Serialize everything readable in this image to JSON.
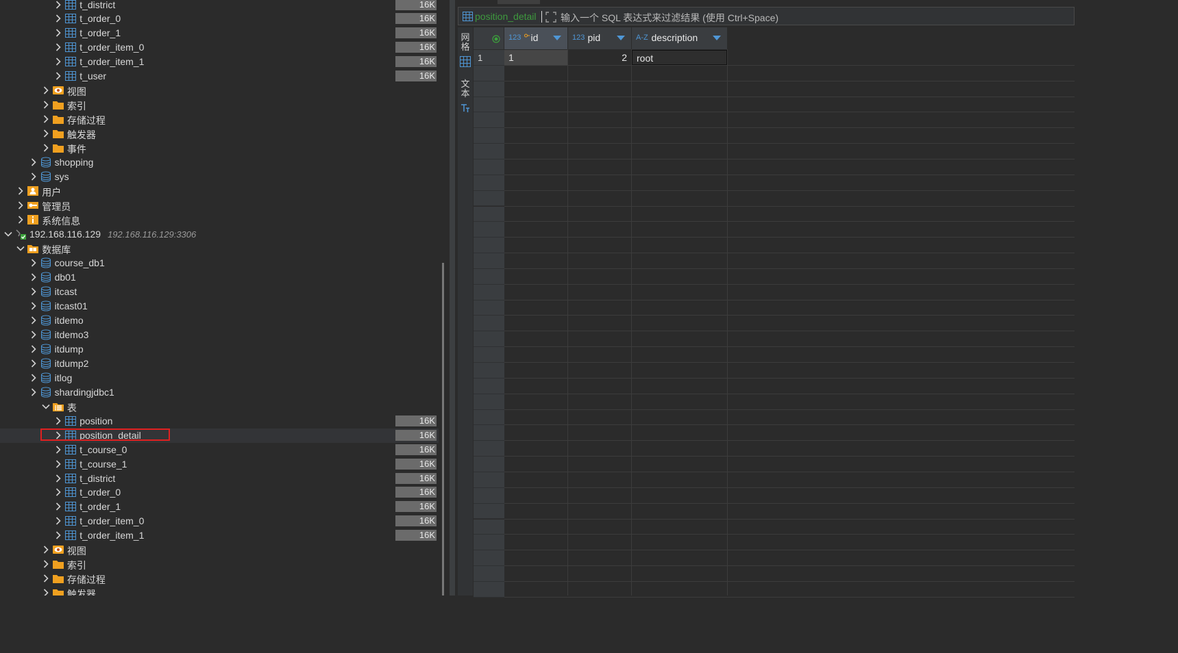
{
  "tree": {
    "sizes_label": "16K",
    "connection": {
      "host": "192.168.116.129",
      "address": "192.168.116.129:3306"
    },
    "rows": [
      {
        "label": "t_district",
        "type": "table",
        "size": "16K"
      },
      {
        "label": "t_order_0",
        "type": "table",
        "size": "16K"
      },
      {
        "label": "t_order_1",
        "type": "table",
        "size": "16K"
      },
      {
        "label": "t_order_item_0",
        "type": "table",
        "size": "16K"
      },
      {
        "label": "t_order_item_1",
        "type": "table",
        "size": "16K"
      },
      {
        "label": "t_user",
        "type": "table",
        "size": "16K"
      },
      {
        "label": "视图",
        "type": "views"
      },
      {
        "label": "索引",
        "type": "folder"
      },
      {
        "label": "存储过程",
        "type": "folder"
      },
      {
        "label": "触发器",
        "type": "folder"
      },
      {
        "label": "事件",
        "type": "folder"
      },
      {
        "label": "shopping",
        "type": "db"
      },
      {
        "label": "sys",
        "type": "db"
      },
      {
        "label": "用户",
        "type": "users"
      },
      {
        "label": "管理员",
        "type": "admin"
      },
      {
        "label": "系统信息",
        "type": "info"
      },
      {
        "label": "192.168.116.129",
        "type": "connection",
        "sub": "192.168.116.129:3306"
      },
      {
        "label": "数据库",
        "type": "databases"
      },
      {
        "label": "course_db1",
        "type": "db"
      },
      {
        "label": "db01",
        "type": "db"
      },
      {
        "label": "itcast",
        "type": "db"
      },
      {
        "label": "itcast01",
        "type": "db"
      },
      {
        "label": "itdemo",
        "type": "db"
      },
      {
        "label": "itdemo3",
        "type": "db"
      },
      {
        "label": "itdump",
        "type": "db"
      },
      {
        "label": "itdump2",
        "type": "db"
      },
      {
        "label": "itlog",
        "type": "db"
      },
      {
        "label": "shardingjdbc1",
        "type": "db"
      },
      {
        "label": "表",
        "type": "tables"
      },
      {
        "label": "position",
        "type": "table",
        "size": "16K"
      },
      {
        "label": "position_detail",
        "type": "table",
        "size": "16K",
        "selected": true
      },
      {
        "label": "t_course_0",
        "type": "table",
        "size": "16K"
      },
      {
        "label": "t_course_1",
        "type": "table",
        "size": "16K"
      },
      {
        "label": "t_district",
        "type": "table",
        "size": "16K"
      },
      {
        "label": "t_order_0",
        "type": "table",
        "size": "16K"
      },
      {
        "label": "t_order_1",
        "type": "table",
        "size": "16K"
      },
      {
        "label": "t_order_item_0",
        "type": "table",
        "size": "16K"
      },
      {
        "label": "t_order_item_1",
        "type": "table",
        "size": "16K"
      },
      {
        "label": "视图",
        "type": "views"
      },
      {
        "label": "索引",
        "type": "folder"
      },
      {
        "label": "存储过程",
        "type": "folder"
      },
      {
        "label": "触发器",
        "type": "folder"
      }
    ]
  },
  "results": {
    "table_name": "position_detail",
    "filter_placeholder": "输入一个 SQL 表达式来过滤结果 (使用 Ctrl+Space)",
    "side_tabs": [
      "网格",
      "文本"
    ],
    "columns": [
      {
        "type": "123",
        "name": "id",
        "key": true
      },
      {
        "type": "123",
        "name": "pid"
      },
      {
        "type": "A-Z",
        "name": "description"
      }
    ],
    "rows": [
      {
        "num": "1",
        "id": "1",
        "pid": "2",
        "description": "root"
      }
    ]
  },
  "colors": {
    "selected_table_text": "#3e9a3e",
    "highlight_border": "#e02020",
    "folder": "#f0a020",
    "db_icon": "#4f97d6"
  }
}
